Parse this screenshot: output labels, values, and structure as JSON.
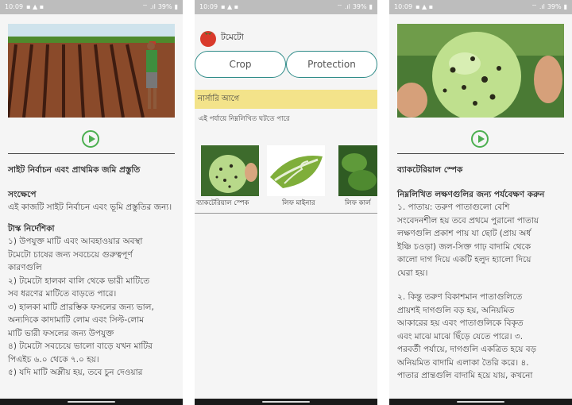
{
  "status_bar": {
    "time": "10:09",
    "battery": "39%"
  },
  "panel1": {
    "section_title": "সাইট নির্বাচন এবং প্রাথমিক জমি প্রস্তুতি",
    "summary_heading": "সংক্ষেপে",
    "summary_text": "এই কাজটি সাইট নির্বাচন এবং ভূমি প্রস্তুতির জন্য।",
    "guideline_heading": "টাস্ক নির্দেশিকা",
    "guideline_lines": [
      "১) উপযুক্ত মাটি এবং আবহাওয়ার অবস্থা",
      "টমেটো চাষের জন্য সবচেয়ে গুরুত্বপূর্ণ",
      "কারণগুলি",
      "২) টমেটো হালকা বালি থেকে ভারী মাটিতে",
      "সব ধরণের মাটিতে বাড়তে পারে।",
      "৩) হালকা মাটি প্রারম্ভিক ফসলের জন্য ভাল,",
      "অন্যদিকে কাদামাটি লোম এবং সিল্ট-লোম",
      "মাটি ভারী ফসলের জন্য উপযুক্ত",
      "৪) টমেটো সবচেয়ে ভালো বাড়ে যখন মাটির",
      "পিএইচ ৬.০ থেকে ৭.০ হয়।",
      "৫) যদি মাটি অম্লীয় হয়, তবে চুন দেওয়ার"
    ]
  },
  "panel2": {
    "app_title": "টমেটো",
    "tabs": [
      "Crop",
      "Protection"
    ],
    "stage_banner": "নার্সারি আগে",
    "stage_subtitle": "এই পর্যায়ে নিম্নলিখিত ঘটতে পারে",
    "cards": [
      {
        "label": "ব্যাকটেরিয়াল স্পেক"
      },
      {
        "label": "লিফ মাইনার"
      },
      {
        "label": "লিফ কার্ল"
      }
    ]
  },
  "panel3": {
    "disease_title": "ব্যাকটেরিয়াল স্পেক",
    "observe_heading": "নিম্নলিখিত লক্ষণগুলির জন্য পর্যবেক্ষণ করুন",
    "para1_lines": [
      "১. পাতায়: তরুণ পাতাগুলো বেশি",
      "সংবেদনশীল হয় তবে প্রথমে পুরানো পাতায়",
      "লক্ষণগুলি প্রকাশ পায় যা ছোট (প্রায় অর্ধ",
      "ইঞ্চি চওড়া) জল-সিক্ত গাঢ় বাদামি থেকে",
      "কালো দাগ দিয়ে একটি হলুদ হ্যালো দিয়ে",
      "ঘেরা হয়।"
    ],
    "para2_lines": [
      "২. কিন্তু তরুণ বিকাশমান পাতাগুলিতে",
      "প্রায়শই দাগগুলি বড় হয়, অনিয়মিত",
      "আকারের হয় এবং পাতাগুলিকে বিকৃত",
      "এবং মাঝে মাঝে ছিঁড়ে যেতে পারে। ৩.",
      "পরবর্তী পর্যায়ে, দাগগুলি একত্রিত হয়ে বড়",
      "অনিয়মিত বাদামি এলাকা তৈরি করে। ৪.",
      "পাতার প্রান্তগুলি বাদামি হয়ে যায়, কখনো"
    ]
  }
}
